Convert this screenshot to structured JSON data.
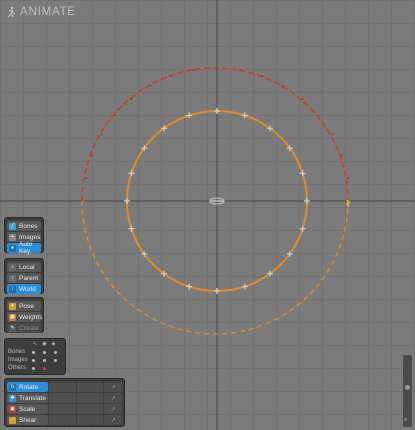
{
  "mode_title": "ANIMATE",
  "toolbar_top": {
    "bones": "Bones",
    "images": "Images",
    "auto_key": "Auto Key"
  },
  "axes": {
    "local": "Local",
    "parent": "Parent",
    "world": "World"
  },
  "pose": {
    "pose": "Pose",
    "weights": "Weights",
    "create": "Create"
  },
  "visibility": {
    "rows": [
      "Bones",
      "Images",
      "Others"
    ]
  },
  "transform": {
    "rotate": "Rotate",
    "translate": "Translate",
    "scale": "Scale",
    "shear": "Shear"
  },
  "colors": {
    "accent": "#2c8ed6",
    "orange_path": "#e08a2e",
    "red_path": "#c8402a",
    "key_yellow": "#f2c01a"
  }
}
